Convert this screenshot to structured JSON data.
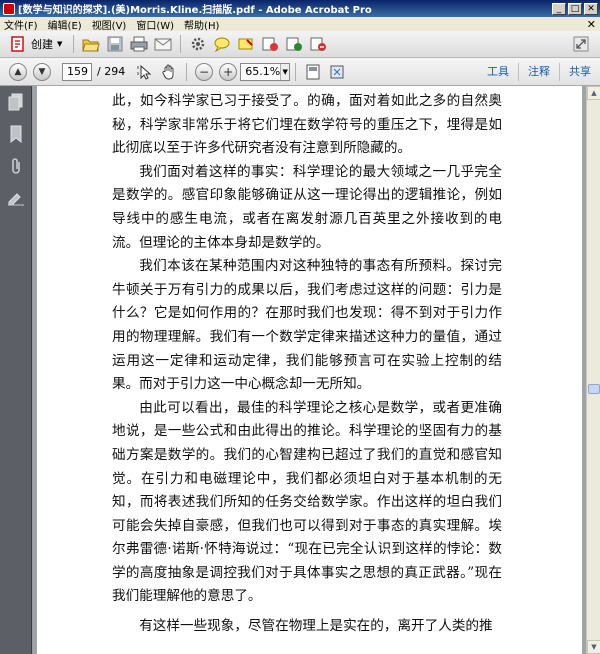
{
  "window": {
    "title": "[数学与知识的探求].(美)Morris.Kline.扫描版.pdf - Adobe Acrobat Pro",
    "minimize": "_",
    "maximize": "□",
    "close": "✕"
  },
  "menubar": {
    "items": [
      "文件(F)",
      "编辑(E)",
      "视图(V)",
      "窗口(W)",
      "帮助(H)"
    ],
    "close": "✕"
  },
  "toolbar": {
    "create_label": "创建",
    "icons": [
      "open-folder-icon",
      "save-icon",
      "print-icon",
      "email-icon",
      "settings-icon",
      "comment-icon",
      "highlight-icon",
      "stamp-icon",
      "sign-icon",
      "attach-icon"
    ]
  },
  "navigation": {
    "current_page": "159",
    "total_pages": "/ 294",
    "zoom": "65.1%"
  },
  "right_tabs": [
    "工具",
    "注释",
    "共享"
  ],
  "document": {
    "paragraphs": [
      "此，如今科学家已习于接受了。的确，面对着如此之多的自然奥秘，科学家非常乐于将它们埋在数学符号的重压之下，埋得是如此彻底以至于许多代研究者没有注意到所隐藏的。",
      "我们面对着这样的事实：科学理论的最大领域之一几乎完全是数学的。感官印象能够确证从这一理论得出的逻辑推论，例如导线中的感生电流，或者在离发射源几百英里之外接收到的电流。但理论的主体本身却是数学的。",
      "我们本该在某种范围内对这种独特的事态有所预料。探讨完牛顿关于万有引力的成果以后，我们考虑过这样的问题：引力是什么？它是如何作用的？在那时我们也发现：得不到对于引力作用的物理理解。我们有一个数学定律来描述这种力的量值，通过运用这一定律和运动定律，我们能够预言可在实验上控制的结果。而对于引力这一中心概念却一无所知。",
      "由此可以看出，最佳的科学理论之核心是数学，或者更准确地说，是一些公式和由此得出的推论。科学理论的坚固有力的基础方案是数学的。我们的心智建构已超过了我们的直觉和感官知觉。在引力和电磁理论中，我们都必须坦白对于基本机制的无知，而将表述我们所知的任务交给数学家。作出这样的坦白我们可能会失掉自豪感，但我们也可以得到对于事态的真实理解。埃尔弗雷德·诺斯·怀特海说过：“现在已完全认识到这样的悖论：数学的高度抽象是调控我们对于具体事实之思想的真正武器。”现在我们能理解他的意思了。",
      "有这样一些现象，尽管在物理上是实在的，离开了人类的推"
    ]
  }
}
